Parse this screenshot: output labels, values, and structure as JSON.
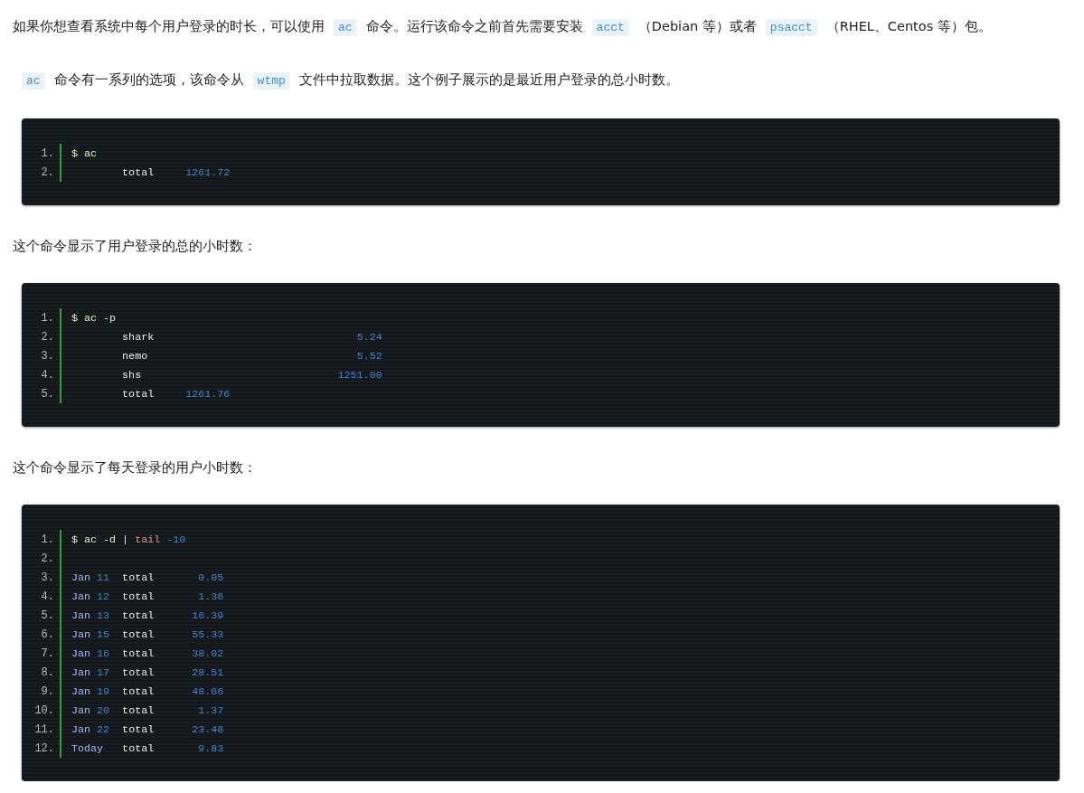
{
  "content": [
    {
      "kind": "paragraph",
      "segments": [
        {
          "kind": "text",
          "text": "如果你想查看系统中每个用户登录的时长，可以使用"
        },
        {
          "kind": "code",
          "text": "ac"
        },
        {
          "kind": "text",
          "text": "命令。运行该命令之前首先需要安装"
        },
        {
          "kind": "code",
          "text": "acct"
        },
        {
          "kind": "text",
          "text": "（Debian 等）或者"
        },
        {
          "kind": "code",
          "text": "psacct"
        },
        {
          "kind": "text",
          "text": "（RHEL、Centos 等）包。"
        }
      ]
    },
    {
      "kind": "paragraph",
      "segments": [
        {
          "kind": "code",
          "text": "ac"
        },
        {
          "kind": "text",
          "text": "命令有一系列的选项，该命令从"
        },
        {
          "kind": "code",
          "text": "wtmp"
        },
        {
          "kind": "text",
          "text": "文件中拉取数据。这个例子展示的是最近用户登录的总小时数。"
        }
      ]
    },
    {
      "kind": "code_block",
      "lines": [
        {
          "number": "1.",
          "tokens": [
            {
              "kind": "prompt",
              "text": "$ ac"
            }
          ]
        },
        {
          "number": "2.",
          "tokens": [
            {
              "kind": "plain",
              "text": "        total     "
            },
            {
              "kind": "number",
              "text": "1261.72"
            }
          ]
        }
      ]
    },
    {
      "kind": "paragraph",
      "segments": [
        {
          "kind": "text",
          "text": "这个命令显示了用户登录的总的小时数："
        }
      ]
    },
    {
      "kind": "code_block",
      "lines": [
        {
          "number": "1.",
          "tokens": [
            {
              "kind": "prompt",
              "text": "$ ac -p"
            }
          ]
        },
        {
          "number": "2.",
          "tokens": [
            {
              "kind": "plain",
              "text": "        shark                                "
            },
            {
              "kind": "number",
              "text": "5.24"
            }
          ]
        },
        {
          "number": "3.",
          "tokens": [
            {
              "kind": "plain",
              "text": "        nemo                                 "
            },
            {
              "kind": "number",
              "text": "5.52"
            }
          ]
        },
        {
          "number": "4.",
          "tokens": [
            {
              "kind": "plain",
              "text": "        shs                               "
            },
            {
              "kind": "number",
              "text": "1251.00"
            }
          ]
        },
        {
          "number": "5.",
          "tokens": [
            {
              "kind": "plain",
              "text": "        total     "
            },
            {
              "kind": "number",
              "text": "1261.76"
            }
          ]
        }
      ]
    },
    {
      "kind": "paragraph",
      "segments": [
        {
          "kind": "text",
          "text": "这个命令显示了每天登录的用户小时数："
        }
      ]
    },
    {
      "kind": "code_block",
      "lines": [
        {
          "number": "1.",
          "tokens": [
            {
              "kind": "prompt",
              "text": "$ ac -d | "
            },
            {
              "kind": "keyword",
              "text": "tail "
            },
            {
              "kind": "number",
              "text": "-10"
            }
          ]
        },
        {
          "number": "2."
        },
        {
          "number": "3.",
          "tokens": [
            {
              "kind": "label",
              "text": "Jan "
            },
            {
              "kind": "number",
              "text": "11"
            },
            {
              "kind": "plain",
              "text": "  total       "
            },
            {
              "kind": "number",
              "text": "0.05"
            }
          ]
        },
        {
          "number": "4.",
          "tokens": [
            {
              "kind": "label",
              "text": "Jan "
            },
            {
              "kind": "number",
              "text": "12"
            },
            {
              "kind": "plain",
              "text": "  total       "
            },
            {
              "kind": "number",
              "text": "1.36"
            }
          ]
        },
        {
          "number": "5.",
          "tokens": [
            {
              "kind": "label",
              "text": "Jan "
            },
            {
              "kind": "number",
              "text": "13"
            },
            {
              "kind": "plain",
              "text": "  total      "
            },
            {
              "kind": "number",
              "text": "16.39"
            }
          ]
        },
        {
          "number": "6.",
          "tokens": [
            {
              "kind": "label",
              "text": "Jan "
            },
            {
              "kind": "number",
              "text": "15"
            },
            {
              "kind": "plain",
              "text": "  total      "
            },
            {
              "kind": "number",
              "text": "55.33"
            }
          ]
        },
        {
          "number": "7.",
          "tokens": [
            {
              "kind": "label",
              "text": "Jan "
            },
            {
              "kind": "number",
              "text": "16"
            },
            {
              "kind": "plain",
              "text": "  total      "
            },
            {
              "kind": "number",
              "text": "38.02"
            }
          ]
        },
        {
          "number": "8.",
          "tokens": [
            {
              "kind": "label",
              "text": "Jan "
            },
            {
              "kind": "number",
              "text": "17"
            },
            {
              "kind": "plain",
              "text": "  total      "
            },
            {
              "kind": "number",
              "text": "28.51"
            }
          ]
        },
        {
          "number": "9.",
          "tokens": [
            {
              "kind": "label",
              "text": "Jan "
            },
            {
              "kind": "number",
              "text": "19"
            },
            {
              "kind": "plain",
              "text": "  total      "
            },
            {
              "kind": "number",
              "text": "48.66"
            }
          ]
        },
        {
          "number": "10.",
          "tokens": [
            {
              "kind": "label",
              "text": "Jan "
            },
            {
              "kind": "number",
              "text": "20"
            },
            {
              "kind": "plain",
              "text": "  total       "
            },
            {
              "kind": "number",
              "text": "1.37"
            }
          ]
        },
        {
          "number": "11.",
          "tokens": [
            {
              "kind": "label",
              "text": "Jan "
            },
            {
              "kind": "number",
              "text": "22"
            },
            {
              "kind": "plain",
              "text": "  total      "
            },
            {
              "kind": "number",
              "text": "23.48"
            }
          ]
        },
        {
          "number": "12.",
          "tokens": [
            {
              "kind": "label",
              "text": "Today"
            },
            {
              "kind": "plain",
              "text": "   total       "
            },
            {
              "kind": "number",
              "text": "9.83"
            }
          ]
        }
      ]
    }
  ]
}
